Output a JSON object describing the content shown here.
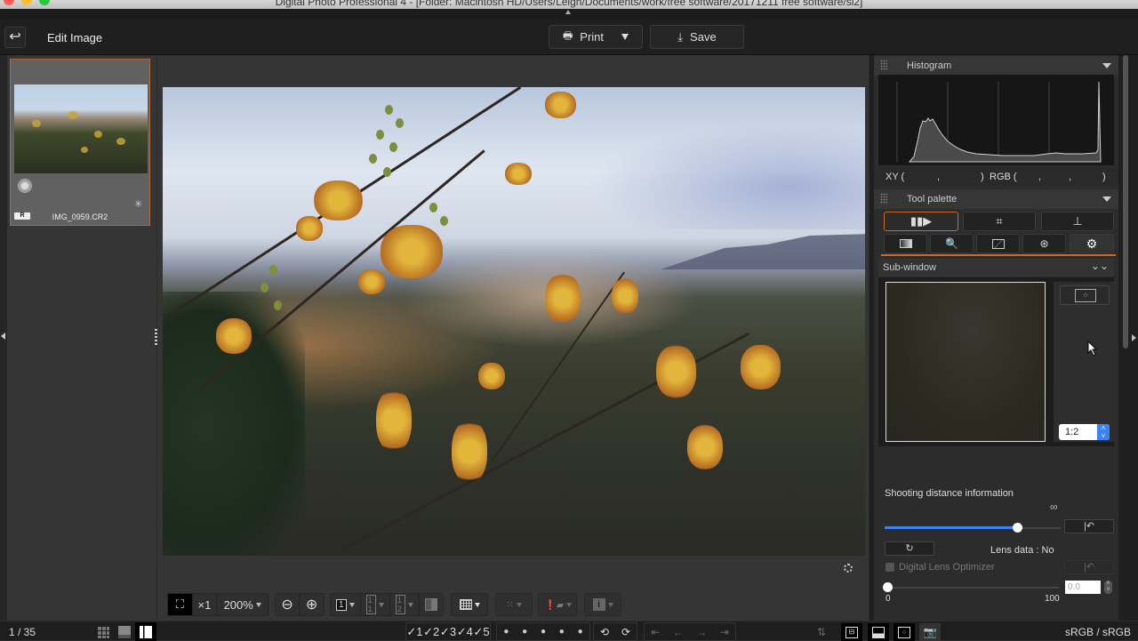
{
  "window": {
    "title": "Digital Photo Professional 4 - [Folder: Macintosh HD/Users/Leigh/Documents/work/free software/20171211 free software/si2]",
    "traffic_lights": {
      "close": "#ff5f57",
      "minimize": "#febc2e",
      "zoom": "#28c840"
    }
  },
  "toolbar": {
    "back_icon": "undo-arrow-icon",
    "mode_title": "Edit Image",
    "print_label": "Print",
    "save_label": "Save"
  },
  "thumbnail": {
    "filename": "IMG_0959.CR2",
    "raw_badge": "R",
    "selected_border": "#b06a3a"
  },
  "viewer": {
    "fit_icon": "fit-to-screen-icon",
    "magnify_label": "×1",
    "zoom_level": "200%",
    "zoom_out_icon": "⊖",
    "zoom_in_icon": "⊕",
    "single_view_label": "1",
    "compare_label_a": "1 1",
    "compare_label_b": "1 2",
    "grid_icon": "grid-icon",
    "info_icon": "i"
  },
  "right_panel": {
    "histogram": {
      "title": "Histogram",
      "xy_label": "XY (",
      "xy_sep": ",",
      "xy_close": ")",
      "rgb_label": "RGB (",
      "rgb_sep1": ",",
      "rgb_sep2": ",",
      "rgb_close": ")"
    },
    "tool_palette": {
      "title": "Tool palette",
      "top_tabs": [
        "lens-correction",
        "crop",
        "stamp"
      ],
      "sub_tabs": [
        "basic",
        "tone-detail",
        "tone-curve",
        "color",
        "settings"
      ],
      "active_top": 0,
      "active_sub": 4,
      "accent": "#c96a2a"
    },
    "sub_window": {
      "title": "Sub-window",
      "ratio": "1:2"
    },
    "shooting_distance": {
      "label": "Shooting distance information",
      "infinity": "∞",
      "value_fraction": 0.75,
      "lens_data_label": "Lens data :",
      "lens_data_value": "No"
    },
    "dlo": {
      "label": "Digital Lens Optimizer",
      "checked": false,
      "value": "0.0",
      "min_label": "0",
      "max_label": "100",
      "value_fraction": 0.0
    }
  },
  "statusbar": {
    "counter": "1 / 35",
    "ratings": [
      "1",
      "2",
      "3",
      "4",
      "5"
    ],
    "color_space": "sRGB / sRGB"
  }
}
